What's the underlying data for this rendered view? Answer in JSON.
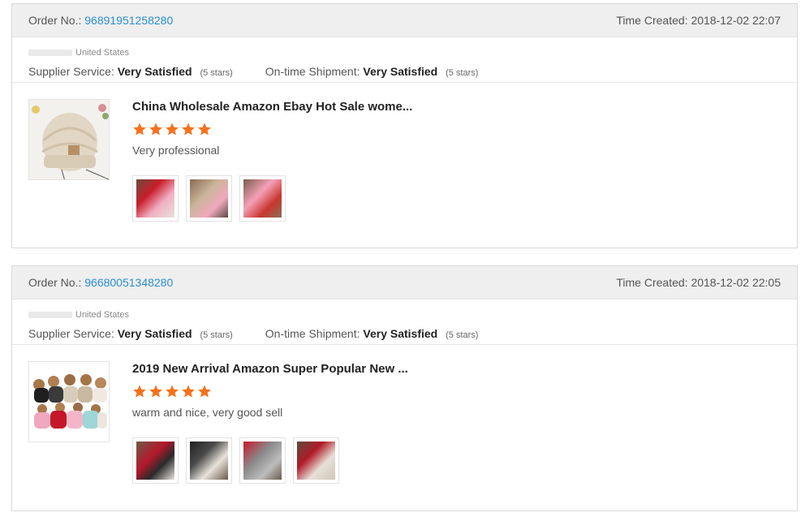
{
  "orders": [
    {
      "order_label": "Order No.:",
      "order_no": "96891951258280",
      "time_label": "Time Created:",
      "time": "2018-12-02 22:07",
      "buyer_country": "United States",
      "supplier_label": "Supplier Service:",
      "supplier_value": "Very Satisfied",
      "supplier_stars": "(5 stars)",
      "shipment_label": "On-time Shipment:",
      "shipment_value": "Very Satisfied",
      "shipment_stars": "(5 stars)",
      "product_title": "China Wholesale Amazon Ebay Hot Sale wome...",
      "rating": 5,
      "comment": "Very professional",
      "photo_count": 3
    },
    {
      "order_label": "Order No.:",
      "order_no": "96680051348280",
      "time_label": "Time Created:",
      "time": "2018-12-02 22:05",
      "buyer_country": "United States",
      "supplier_label": "Supplier Service:",
      "supplier_value": "Very Satisfied",
      "supplier_stars": "(5 stars)",
      "shipment_label": "On-time Shipment:",
      "shipment_value": "Very Satisfied",
      "shipment_stars": "(5 stars)",
      "product_title": "2019 New Arrival Amazon Super Popular New ...",
      "rating": 5,
      "comment": "warm and nice, very good sell",
      "photo_count": 4
    }
  ],
  "colors": {
    "link": "#2a8fd0",
    "star": "#f5721c"
  }
}
